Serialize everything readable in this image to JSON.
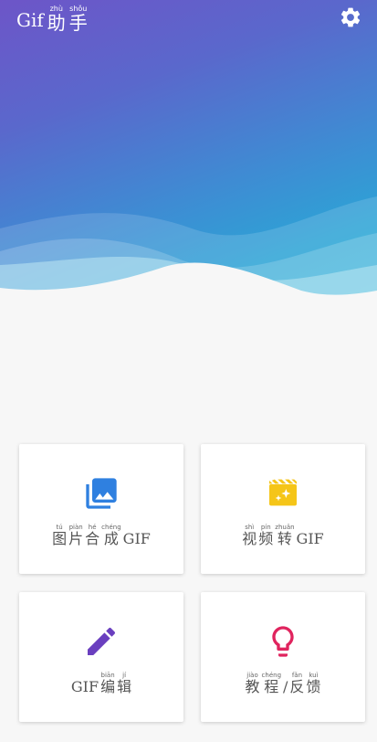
{
  "header": {
    "title_latin": "Gif",
    "title_chars": [
      {
        "hz": "助",
        "py": "zhù"
      },
      {
        "hz": "手",
        "py": "shǒu"
      }
    ],
    "settings_icon": "gear-icon"
  },
  "colors": {
    "gradient_top": "#6d55c8",
    "gradient_bottom": "#2aa7d6",
    "icon_blue": "#2f80e0",
    "icon_yellow": "#f5c518",
    "icon_purple": "#6a3fbf",
    "icon_pink": "#e0245e"
  },
  "cards": [
    {
      "icon": "images-icon",
      "chars": [
        {
          "hz": "图",
          "py": "tú"
        },
        {
          "hz": "片",
          "py": "piàn"
        },
        {
          "hz": "合",
          "py": "hé"
        },
        {
          "hz": "成",
          "py": "chéng"
        }
      ],
      "suffix": "GIF"
    },
    {
      "icon": "movie-sparkle-icon",
      "chars": [
        {
          "hz": "视",
          "py": "shì"
        },
        {
          "hz": "频",
          "py": "pín"
        },
        {
          "hz": "转",
          "py": "zhuǎn"
        }
      ],
      "suffix": "GIF"
    },
    {
      "icon": "pencil-icon",
      "prefix": "GIF",
      "chars": [
        {
          "hz": "编",
          "py": "biān"
        },
        {
          "hz": "辑",
          "py": "jí"
        }
      ]
    },
    {
      "icon": "lightbulb-icon",
      "chars": [
        {
          "hz": "教",
          "py": "jiào"
        },
        {
          "hz": "程",
          "py": "chéng"
        }
      ],
      "sep": "/",
      "chars2": [
        {
          "hz": "反",
          "py": "fǎn"
        },
        {
          "hz": "馈",
          "py": "kuì"
        }
      ]
    }
  ]
}
